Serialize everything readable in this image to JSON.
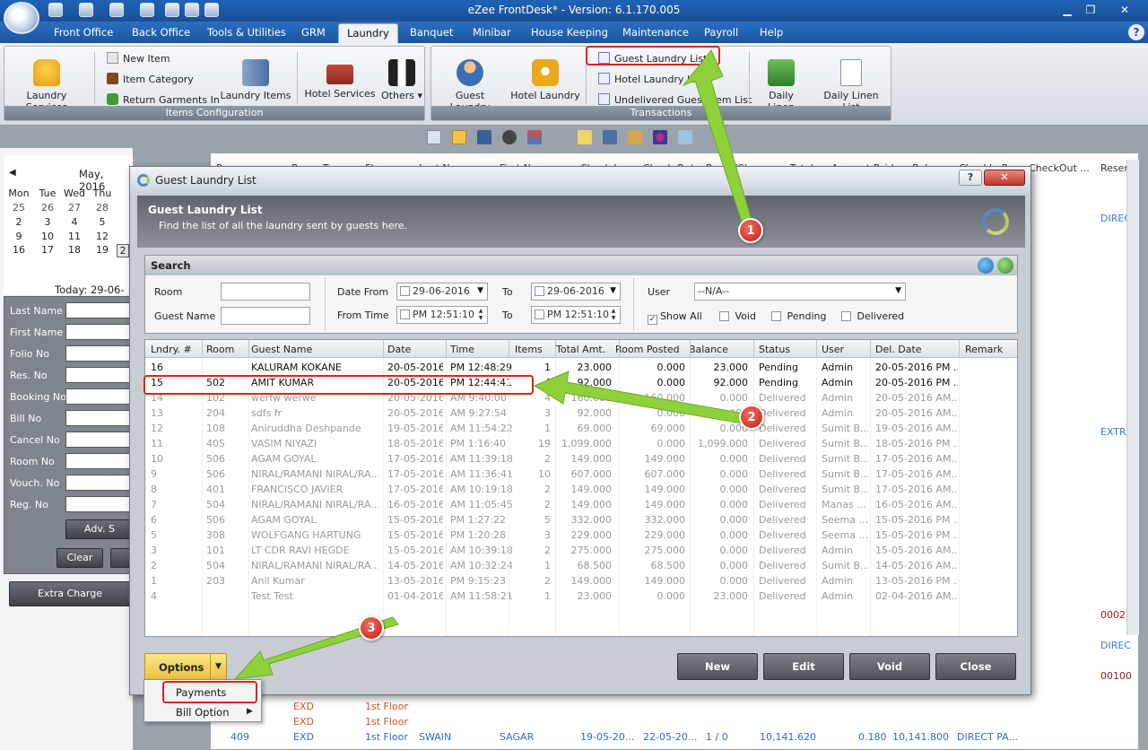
{
  "window": {
    "title": "eZee FrontDesk* - Version: 6.1.170.005"
  },
  "menu": [
    "Front Office",
    "Back Office",
    "Tools & Utilities",
    "GRM",
    "Laundry",
    "Banquet",
    "Minibar",
    "House Keeping",
    "Maintenance",
    "Payroll",
    "Help"
  ],
  "ribbon": {
    "items_config": {
      "title": "Items Configuration",
      "laundry_services": "Laundry Services",
      "new_item": "New Item",
      "item_category": "Item Category",
      "return_garments": "Return Garments In",
      "laundry_items": "Laundry Items",
      "hotel_services": "Hotel Services",
      "others": "Others"
    },
    "transactions": {
      "title": "Transactions",
      "guest_laundry": "Guest Laundry",
      "hotel_laundry": "Hotel Laundry",
      "guest_laundry_list": "Guest Laundry List",
      "hotel_laundry_list": "Hotel Laundry List",
      "undelivered": "Undelivered Guest Item List",
      "daily_linen": "Daily Linen",
      "daily_linen_list": "Daily Linen List"
    }
  },
  "calendar": {
    "month": "May, 2016",
    "days": [
      "Mon",
      "Tue",
      "Wed",
      "Thu"
    ],
    "rows": [
      [
        "25",
        "26",
        "27",
        "28"
      ],
      [
        "2",
        "3",
        "4",
        "5"
      ],
      [
        "9",
        "10",
        "11",
        "12"
      ],
      [
        "16",
        "17",
        "18",
        "19"
      ]
    ],
    "extra": "2",
    "today": "Today: 29-06-20"
  },
  "side_search": {
    "fields": [
      "Last Name",
      "First Name",
      "Folio No",
      "Res. No",
      "Booking No",
      "Bill No",
      "Cancel No",
      "Room No",
      "Vouch. No",
      "Reg. No"
    ],
    "adv": "Adv. S",
    "clear": "Clear",
    "extra_charge": "Extra Charge"
  },
  "background_grid": {
    "headers": [
      "Room",
      "Room Type",
      "Floor",
      "Last Name",
      "First Name",
      "Check In",
      "Check Out",
      "Pax(A/C)",
      "Total",
      "Amount Paid",
      "Balance",
      "CheckIn By",
      "CheckOut ...",
      "Reser"
    ],
    "right_texts": [
      "DIREC",
      "EXTRA",
      "00028",
      "DIREC",
      "00100"
    ],
    "bottom_rows": [
      [
        "",
        "EXD",
        "1st Floor",
        "",
        "",
        "",
        "",
        "",
        "",
        "",
        "",
        ""
      ],
      [
        "",
        "EXD",
        "1st Floor",
        "",
        "",
        "",
        "",
        "",
        "",
        "",
        "",
        ""
      ],
      [
        "409",
        "EXD",
        "1st Floor",
        "SWAIN",
        "SAGAR",
        "19-05-20...",
        "22-05-20...",
        "1 / 0",
        "10,141.620",
        "0.180",
        "10,141.800",
        "DIRECT PA..."
      ]
    ]
  },
  "dialog": {
    "title": "Guest Laundry List",
    "header_title": "Guest Laundry List",
    "header_desc": "Find the list of all the laundry sent by guests here.",
    "search": {
      "title": "Search",
      "room_label": "Room",
      "guest_label": "Guest Name",
      "date_from_label": "Date From",
      "date_from": "29-06-2016",
      "to_label": "To",
      "date_to": "29-06-2016",
      "from_time_label": "From Time",
      "from_time": "PM 12:51:10",
      "to_time": "PM 12:51:10",
      "user_label": "User",
      "user_value": "--N/A--",
      "show_all": "Show All",
      "void": "Void",
      "pending": "Pending",
      "delivered": "Delivered"
    },
    "table": {
      "headers": [
        "Lndry. #",
        "Room",
        "Guest Name",
        "Date",
        "Time",
        "Items",
        "Total Amt.",
        "Room Posted",
        "Balance",
        "Status",
        "User",
        "Del. Date",
        "Remark"
      ],
      "rows": [
        [
          "16",
          "",
          "KALURAM KOKANE",
          "20-05-2016",
          "PM 12:48:29",
          "1",
          "23.000",
          "0.000",
          "23.000",
          "Pending",
          "Admin",
          "20-05-2016 PM ...",
          ""
        ],
        [
          "15",
          "502",
          "AMIT KUMAR",
          "20-05-2016",
          "PM 12:44:41",
          "4",
          "92.000",
          "0.000",
          "92.000",
          "Pending",
          "Admin",
          "20-05-2016 PM ...",
          ""
        ],
        [
          "14",
          "102",
          "werfw werwe",
          "20-05-2016",
          "AM 9:40:00",
          "4",
          "160.000",
          "160.000",
          "0.000",
          "Delivered",
          "Admin",
          "20-05-2016 AM...",
          ""
        ],
        [
          "13",
          "204",
          "sdfs fr",
          "20-05-2016",
          "AM 9:27:54",
          "3",
          "92.000",
          "0.000",
          "92.000",
          "Delivered",
          "Admin",
          "20-05-2016 AM...",
          ""
        ],
        [
          "12",
          "108",
          "Aniruddha Deshpande",
          "19-05-2016",
          "AM 11:54:22",
          "1",
          "69.000",
          "69.000",
          "0.000",
          "Delivered",
          "Sumit B...",
          "19-05-2016 AM...",
          ""
        ],
        [
          "11",
          "405",
          "VASIM NIYAZI",
          "18-05-2016",
          "PM 1:16:40",
          "19",
          "1,099.000",
          "0.000",
          "1,099.000",
          "Delivered",
          "Sumit B...",
          "18-05-2016 PM ...",
          ""
        ],
        [
          "10",
          "506",
          "AGAM GOYAL",
          "17-05-2016",
          "AM 11:39:18",
          "2",
          "149.000",
          "149.000",
          "0.000",
          "Delivered",
          "Sumit B...",
          "17-05-2016 AM...",
          ""
        ],
        [
          "9",
          "506",
          "NIRAL/RAMANI NIRAL/RA...",
          "17-05-2016",
          "AM 11:36:41",
          "10",
          "607.000",
          "607.000",
          "0.000",
          "Delivered",
          "Sumit B...",
          "17-05-2016 AM...",
          ""
        ],
        [
          "8",
          "401",
          "FRANCISCO JAVIER",
          "17-05-2016",
          "AM 10:19:18",
          "2",
          "149.000",
          "149.000",
          "0.000",
          "Delivered",
          "Sumit B...",
          "17-05-2016 AM...",
          ""
        ],
        [
          "7",
          "504",
          "NIRAL/RAMANI NIRAL/RA...",
          "16-05-2016",
          "AM 11:05:45",
          "2",
          "149.000",
          "149.000",
          "0.000",
          "Delivered",
          "Manas ...",
          "16-05-2016 AM...",
          ""
        ],
        [
          "6",
          "506",
          "AGAM GOYAL",
          "15-05-2016",
          "PM 1:27:22",
          "5",
          "332.000",
          "332.000",
          "0.000",
          "Delivered",
          "Seema ...",
          "15-05-2016 PM ...",
          ""
        ],
        [
          "5",
          "308",
          "WOLFGANG HARTUNG",
          "15-05-2016",
          "PM 1:20:28",
          "3",
          "229.000",
          "229.000",
          "0.000",
          "Delivered",
          "Seema ...",
          "15-05-2016 PM ...",
          ""
        ],
        [
          "3",
          "101",
          "LT CDR RAVI HEGDE",
          "15-05-2016",
          "AM 10:39:18",
          "2",
          "275.000",
          "275.000",
          "0.000",
          "Delivered",
          "Admin",
          "15-05-2016 AM...",
          ""
        ],
        [
          "2",
          "504",
          "NIRAL/RAMANI NIRAL/RA...",
          "14-05-2016",
          "AM 10:32:24",
          "1",
          "68.500",
          "68.500",
          "0.000",
          "Delivered",
          "Sumit B...",
          "14-05-2016 AM...",
          ""
        ],
        [
          "1",
          "203",
          "Anil Kumar",
          "13-05-2016",
          "PM 9:15:23",
          "2",
          "149.000",
          "149.000",
          "0.000",
          "Delivered",
          "Admin",
          "13-05-2016 PM ...",
          ""
        ],
        [
          "4",
          "",
          "Test Test",
          "01-04-2016",
          "AM 11:58:21",
          "1",
          "23.000",
          "0.000",
          "23.000",
          "Delivered",
          "Admin",
          "02-04-2016 AM...",
          ""
        ]
      ]
    },
    "buttons": {
      "options": "Options",
      "new": "New",
      "edit": "Edit",
      "void": "Void",
      "close": "Close"
    },
    "options_menu": {
      "payments": "Payments",
      "bill_option": "Bill Option"
    }
  },
  "annotations": {
    "one": "1",
    "two": "2",
    "three": "3",
    "arrow_color": "#8ed13a",
    "highlight_color": "#d9261c"
  }
}
